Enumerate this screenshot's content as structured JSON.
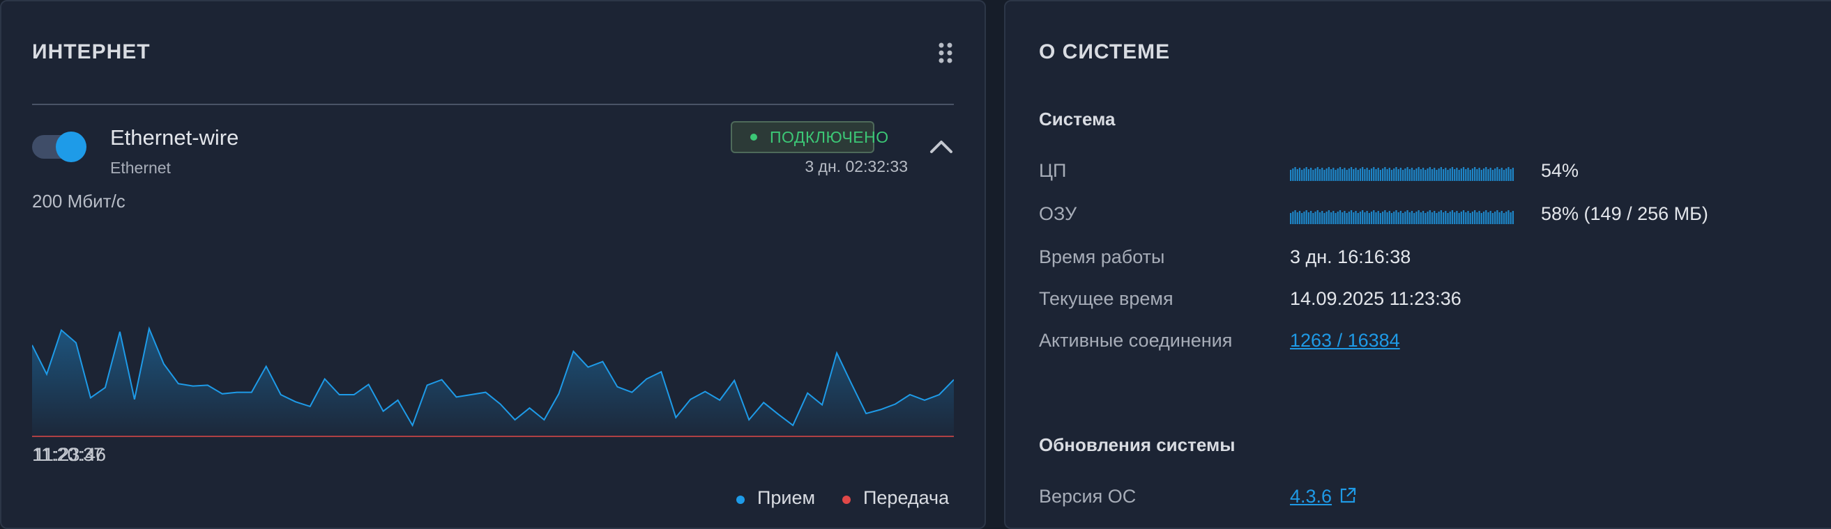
{
  "internet": {
    "title": "ИНТЕРНЕТ",
    "interface": {
      "name": "Ethernet-wire",
      "type": "Ethernet",
      "enabled": true,
      "status": "ПОДКЛЮЧЕНО",
      "uptime": "3 дн. 02:32:33"
    },
    "speed_label": "200 Мбит/с",
    "time_start": "11:20:37",
    "time_end": "11:23:46",
    "legend": {
      "rx": "Прием",
      "tx": "Передача"
    },
    "colors": {
      "rx": "#1e9be8",
      "tx": "#e04848",
      "connected": "#3cc776"
    }
  },
  "chart_data": {
    "type": "area",
    "title": "",
    "xlabel": "",
    "ylabel": "",
    "x_start": "11:20:37",
    "x_end": "11:23:46",
    "ylim": [
      0,
      200
    ],
    "series": [
      {
        "name": "Прием",
        "values": [
          117,
          80,
          136,
          120,
          50,
          63,
          134,
          48,
          138,
          93,
          68,
          65,
          66,
          55,
          57,
          57,
          90,
          54,
          45,
          39,
          74,
          54,
          54,
          67,
          33,
          47,
          15,
          66,
          73,
          51,
          54,
          57,
          42,
          22,
          37,
          22,
          55,
          109,
          89,
          96,
          64,
          57,
          74,
          83,
          25,
          48,
          58,
          47,
          72,
          22,
          44,
          29,
          15,
          56,
          41,
          107,
          68,
          30,
          35,
          42,
          54,
          47,
          54,
          73
        ]
      },
      {
        "name": "Передача",
        "values": [
          1,
          1,
          1,
          1,
          1,
          1,
          1,
          1,
          1,
          1,
          1,
          1,
          1,
          1,
          1,
          1,
          1,
          1,
          1,
          1,
          1,
          1,
          1,
          1,
          1,
          1,
          1,
          1,
          1,
          1,
          1,
          1,
          1,
          1,
          1,
          1,
          1,
          1,
          1,
          1,
          1,
          1,
          1,
          1,
          1,
          1,
          1,
          1,
          1,
          1,
          1,
          1,
          1,
          1,
          1,
          1,
          1,
          1,
          1,
          1,
          1,
          1,
          1,
          1
        ]
      }
    ]
  },
  "system": {
    "title": "О СИСТЕМЕ",
    "section": "Система",
    "cpu": {
      "label": "ЦП",
      "percent": 54,
      "value": "54%"
    },
    "ram": {
      "label": "ОЗУ",
      "percent": 58,
      "value": "58% (149 / 256 МБ)"
    },
    "uptime": {
      "label": "Время работы",
      "value": "3 дн. 16:16:38"
    },
    "current_time": {
      "label": "Текущее время",
      "value": "14.09.2025 11:23:36"
    },
    "connections": {
      "label": "Активные соединения",
      "value": "1263 / 16384"
    },
    "updates_section": "Обновления системы",
    "os_version": {
      "label": "Версия ОС",
      "value": "4.3.6"
    }
  }
}
